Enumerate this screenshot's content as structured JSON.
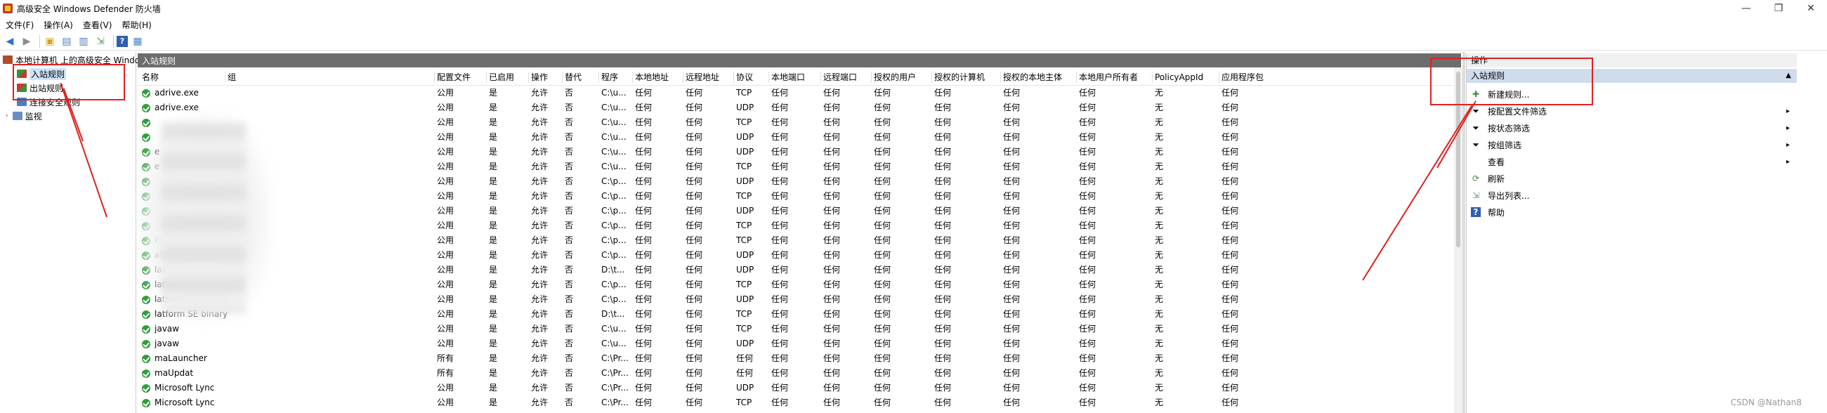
{
  "window": {
    "title": "高级安全 Windows Defender 防火墙",
    "minimize": "—",
    "maximize": "❐",
    "close": "✕"
  },
  "menu": [
    "文件(F)",
    "操作(A)",
    "查看(V)",
    "帮助(H)"
  ],
  "tree": {
    "root": "本地计算机 上的高级安全 Windo",
    "inbound": "入站规则",
    "outbound": "出站规则",
    "security": "连接安全规则",
    "monitor": "监视"
  },
  "center": {
    "header": "入站规则",
    "columns": [
      "名称",
      "组",
      "配置文件",
      "已启用",
      "操作",
      "替代",
      "程序",
      "本地地址",
      "远程地址",
      "协议",
      "本地端口",
      "远程端口",
      "授权的用户",
      "授权的计算机",
      "授权的本地主体",
      "本地用户所有者",
      "PolicyAppId",
      "应用程序包"
    ],
    "rows": [
      [
        "adrive.exe",
        "",
        "公用",
        "是",
        "允许",
        "否",
        "C:\\u...",
        "任何",
        "任何",
        "TCP",
        "任何",
        "任何",
        "任何",
        "任何",
        "任何",
        "任何",
        "无",
        "任何"
      ],
      [
        "adrive.exe",
        "",
        "公用",
        "是",
        "允许",
        "否",
        "C:\\u...",
        "任何",
        "任何",
        "UDP",
        "任何",
        "任何",
        "任何",
        "任何",
        "任何",
        "任何",
        "无",
        "任何"
      ],
      [
        "",
        "",
        "公用",
        "是",
        "允许",
        "否",
        "C:\\u...",
        "任何",
        "任何",
        "TCP",
        "任何",
        "任何",
        "任何",
        "任何",
        "任何",
        "任何",
        "无",
        "任何"
      ],
      [
        "",
        "",
        "公用",
        "是",
        "允许",
        "否",
        "C:\\u...",
        "任何",
        "任何",
        "UDP",
        "任何",
        "任何",
        "任何",
        "任何",
        "任何",
        "任何",
        "无",
        "任何"
      ],
      [
        "e",
        "",
        "公用",
        "是",
        "允许",
        "否",
        "C:\\u...",
        "任何",
        "任何",
        "UDP",
        "任何",
        "任何",
        "任何",
        "任何",
        "任何",
        "任何",
        "无",
        "任何"
      ],
      [
        "e",
        "",
        "公用",
        "是",
        "允许",
        "否",
        "C:\\u...",
        "任何",
        "任何",
        "TCP",
        "任何",
        "任何",
        "任何",
        "任何",
        "任何",
        "任何",
        "无",
        "任何"
      ],
      [
        "",
        "",
        "公用",
        "是",
        "允许",
        "否",
        "C:\\p...",
        "任何",
        "任何",
        "UDP",
        "任何",
        "任何",
        "任何",
        "任何",
        "任何",
        "任何",
        "无",
        "任何"
      ],
      [
        "",
        "",
        "公用",
        "是",
        "允许",
        "否",
        "C:\\p...",
        "任何",
        "任何",
        "TCP",
        "任何",
        "任何",
        "任何",
        "任何",
        "任何",
        "任何",
        "无",
        "任何"
      ],
      [
        "",
        "",
        "公用",
        "是",
        "允许",
        "否",
        "C:\\p...",
        "任何",
        "任何",
        "UDP",
        "任何",
        "任何",
        "任何",
        "任何",
        "任何",
        "任何",
        "无",
        "任何"
      ],
      [
        "",
        "",
        "公用",
        "是",
        "允许",
        "否",
        "C:\\p...",
        "任何",
        "任何",
        "TCP",
        "任何",
        "任何",
        "任何",
        "任何",
        "任何",
        "任何",
        "无",
        "任何"
      ],
      [
        "Platform SE binary",
        "",
        "公用",
        "是",
        "允许",
        "否",
        "C:\\p...",
        "任何",
        "任何",
        "TCP",
        "任何",
        "任何",
        "任何",
        "任何",
        "任何",
        "任何",
        "无",
        "任何"
      ],
      [
        "atform SE binary",
        "",
        "公用",
        "是",
        "允许",
        "否",
        "C:\\p...",
        "任何",
        "任何",
        "UDP",
        "任何",
        "任何",
        "任何",
        "任何",
        "任何",
        "任何",
        "无",
        "任何"
      ],
      [
        "latform SE binary",
        "",
        "公用",
        "是",
        "允许",
        "否",
        "D:\\t...",
        "任何",
        "任何",
        "UDP",
        "任何",
        "任何",
        "任何",
        "任何",
        "任何",
        "任何",
        "无",
        "任何"
      ],
      [
        "latform SE binary",
        "",
        "公用",
        "是",
        "允许",
        "否",
        "C:\\p...",
        "任何",
        "任何",
        "TCP",
        "任何",
        "任何",
        "任何",
        "任何",
        "任何",
        "任何",
        "无",
        "任何"
      ],
      [
        "latform SE binary",
        "",
        "公用",
        "是",
        "允许",
        "否",
        "C:\\p...",
        "任何",
        "任何",
        "UDP",
        "任何",
        "任何",
        "任何",
        "任何",
        "任何",
        "任何",
        "无",
        "任何"
      ],
      [
        "latform SE binary",
        "",
        "公用",
        "是",
        "允许",
        "否",
        "D:\\t...",
        "任何",
        "任何",
        "TCP",
        "任何",
        "任何",
        "任何",
        "任何",
        "任何",
        "任何",
        "无",
        "任何"
      ],
      [
        "javaw",
        "",
        "公用",
        "是",
        "允许",
        "否",
        "C:\\u...",
        "任何",
        "任何",
        "TCP",
        "任何",
        "任何",
        "任何",
        "任何",
        "任何",
        "任何",
        "无",
        "任何"
      ],
      [
        "javaw",
        "",
        "公用",
        "是",
        "允许",
        "否",
        "C:\\u...",
        "任何",
        "任何",
        "UDP",
        "任何",
        "任何",
        "任何",
        "任何",
        "任何",
        "任何",
        "无",
        "任何"
      ],
      [
        "maLauncher",
        "",
        "所有",
        "是",
        "允许",
        "否",
        "C:\\Pr...",
        "任何",
        "任何",
        "任何",
        "任何",
        "任何",
        "任何",
        "任何",
        "任何",
        "任何",
        "无",
        "任何"
      ],
      [
        "maUpdat",
        "",
        "所有",
        "是",
        "允许",
        "否",
        "C:\\Pr...",
        "任何",
        "任何",
        "任何",
        "任何",
        "任何",
        "任何",
        "任何",
        "任何",
        "任何",
        "无",
        "任何"
      ],
      [
        "Microsoft Lync",
        "",
        "公用",
        "是",
        "允许",
        "否",
        "C:\\Pr...",
        "任何",
        "任何",
        "UDP",
        "任何",
        "任何",
        "任何",
        "任何",
        "任何",
        "任何",
        "无",
        "任何"
      ],
      [
        "Microsoft Lync",
        "",
        "公用",
        "是",
        "允许",
        "否",
        "C:\\Pr...",
        "任何",
        "任何",
        "TCP",
        "任何",
        "任何",
        "任何",
        "任何",
        "任何",
        "任何",
        "无",
        "任何"
      ]
    ]
  },
  "actions": {
    "title": "操作",
    "section": "入站规则",
    "collapse": "▲",
    "items": [
      {
        "label": "新建规则...",
        "icon": "new-rule-icon",
        "glyph": "✚",
        "has_submenu": false
      },
      {
        "label": "按配置文件筛选",
        "icon": "filter-icon",
        "glyph": "⏷",
        "has_submenu": true
      },
      {
        "label": "按状态筛选",
        "icon": "filter-icon",
        "glyph": "⏷",
        "has_submenu": true
      },
      {
        "label": "按组筛选",
        "icon": "filter-icon",
        "glyph": "⏷",
        "has_submenu": true
      },
      {
        "label": "查看",
        "icon": "",
        "glyph": "",
        "has_submenu": true
      },
      {
        "label": "刷新",
        "icon": "refresh-icon",
        "glyph": "⟳",
        "has_submenu": false
      },
      {
        "label": "导出列表...",
        "icon": "export-icon",
        "glyph": "⇲",
        "has_submenu": false
      },
      {
        "label": "帮助",
        "icon": "help-icon",
        "glyph": "?",
        "has_submenu": false
      }
    ],
    "submenu_glyph": "▸"
  },
  "watermark": "CSDN @Nathan8",
  "colors": {
    "accent_red": "#e02020",
    "rule_green": "#2e9e3e",
    "section_blue": "#cfdcec"
  }
}
